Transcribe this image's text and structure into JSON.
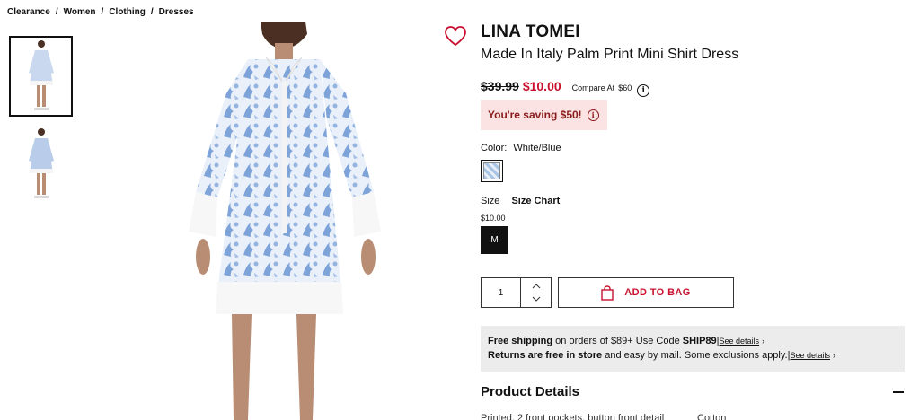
{
  "breadcrumb": [
    "Clearance",
    "Women",
    "Clothing",
    "Dresses"
  ],
  "product": {
    "brand": "LINA TOMEI",
    "name": "Made In Italy Palm Print Mini Shirt Dress",
    "old_price": "$39.99",
    "new_price": "$10.00",
    "compare_label": "Compare At",
    "compare_value": "$60",
    "saving_text": "You're saving $50!",
    "color_label": "Color:",
    "color_value": "White/Blue",
    "size_label": "Size",
    "size_chart_label": "Size Chart",
    "size_price": "$10.00",
    "size_option": "M",
    "quantity": "1",
    "add_to_bag_label": "ADD TO BAG"
  },
  "shipping": {
    "line1_bold": "Free shipping",
    "line1_text": " on orders of $89+ Use Code ",
    "line1_code": "SHIP89",
    "line1_sep": "|",
    "line2_bold": "Returns are free in store",
    "line2_text": " and easy by mail. Some exclusions apply.",
    "line2_sep": "|",
    "see_details": "See details",
    "chevron": "›"
  },
  "details": {
    "title": "Product Details",
    "text_left": "Printed, 2 front pockets, button front detail",
    "text_right": "Cotton"
  },
  "colors": {
    "accent_red": "#c8102e",
    "saving_bg": "#fbe3e3",
    "shipping_bg": "#ececec"
  }
}
